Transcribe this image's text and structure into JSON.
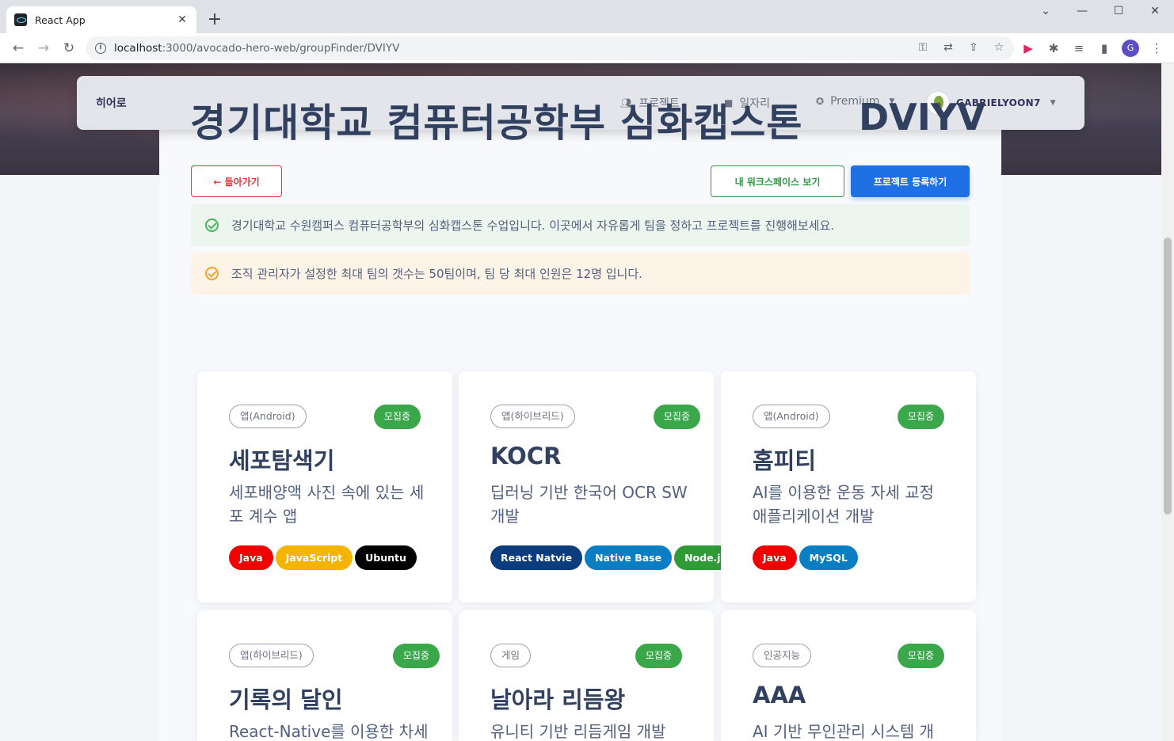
{
  "browser": {
    "tab_title": "React App",
    "tab_close": "✕",
    "new_tab": "+",
    "url_host": "localhost",
    "url_path": ":3000/avocado-hero-web/groupFinder/DVIYV",
    "window_controls": [
      "⌄",
      "—",
      "☐",
      "✕"
    ]
  },
  "navbar": {
    "brand": "히어로",
    "items": [
      {
        "label": "프로젝트",
        "icon": "users-icon"
      },
      {
        "label": "일자리",
        "icon": "briefcase-icon"
      },
      {
        "label": "Premium",
        "icon": "award-icon"
      }
    ],
    "user": "GABRIELYOON7"
  },
  "header": {
    "title": "경기대학교 컴퓨터공학부 심화캡스톤",
    "code": "DVIYV"
  },
  "actions": {
    "back": "← 돌아가기",
    "workspace": "내 워크스페이스 보기",
    "register": "프로젝트 등록하기"
  },
  "alerts": {
    "info": "경기대학교 수원캠퍼스 컴퓨터공학부의 심화캡스톤 수업입니다. 이곳에서 자유롭게 팀을 정하고 프로젝트를 진행해보세요.",
    "limit": "조직 관리자가 설정한 최대 팀의 갯수는 50팀이며, 팀 당 최대 인원은 12명 입니다."
  },
  "projects": [
    {
      "type": "앱(Android)",
      "status": "모집중",
      "name": "세포탐색기",
      "desc": "세포배양액 사진 속에 있는 세포 계수 앱",
      "tags": [
        {
          "label": "Java",
          "color": "#f00000"
        },
        {
          "label": "JavaScript",
          "color": "#f5b400"
        },
        {
          "label": "Ubuntu",
          "color": "#000000"
        }
      ]
    },
    {
      "type": "앱(하이브리드)",
      "status": "모집중",
      "name": "KOCR",
      "desc": "딥러닝 기반 한국어 OCR SW 개발",
      "tags": [
        {
          "label": "React Natvie",
          "color": "#0b3c7d"
        },
        {
          "label": "Native Base",
          "color": "#0a7ec2"
        },
        {
          "label": "Node.js",
          "color": "#2e9b37"
        }
      ]
    },
    {
      "type": "앱(Android)",
      "status": "모집중",
      "name": "홈피티",
      "desc": "AI를 이용한 운동 자세 교정 애플리케이션 개발",
      "tags": [
        {
          "label": "Java",
          "color": "#f00000"
        },
        {
          "label": "MySQL",
          "color": "#0a7ec2"
        }
      ]
    },
    {
      "type": "앱(하이브리드)",
      "status": "모집중",
      "name": "기록의 달인",
      "desc": "React-Native를 이용한 차세",
      "tags": []
    },
    {
      "type": "게임",
      "status": "모집중",
      "name": "날아라 리듬왕",
      "desc": "유니티 기반 리듬게임 개발",
      "tags": []
    },
    {
      "type": "인공지능",
      "status": "모집중",
      "name": "AAA",
      "desc": "AI 기반 무인관리 시스템 개",
      "tags": []
    }
  ]
}
